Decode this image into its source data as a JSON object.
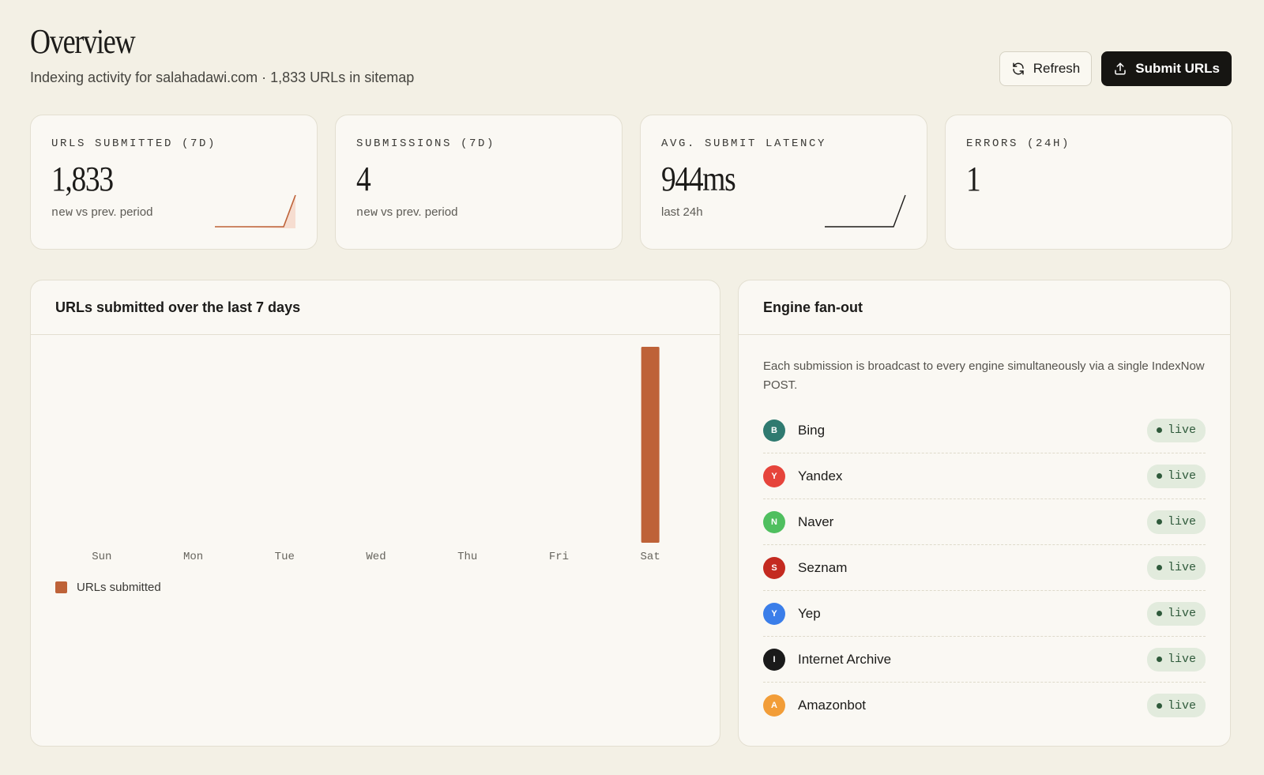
{
  "header": {
    "title": "Overview",
    "subtitle": "Indexing activity for salahadawi.com · 1,833 URLs in sitemap"
  },
  "actions": {
    "refresh_label": "Refresh",
    "submit_label": "Submit URLs"
  },
  "stats": [
    {
      "label": "URLS SUBMITTED (7D)",
      "value": "1,833",
      "note_mono": "new",
      "note_rest": " vs prev. period",
      "spark": "accent"
    },
    {
      "label": "SUBMISSIONS (7D)",
      "value": "4",
      "note_mono": "new",
      "note_rest": " vs prev. period",
      "spark": "none"
    },
    {
      "label": "AVG. SUBMIT LATENCY",
      "value": "944ms",
      "note_mono": "",
      "note_rest": "last 24h",
      "spark": "dark"
    },
    {
      "label": "ERRORS (24H)",
      "value": "1",
      "note_mono": "",
      "note_rest": "",
      "spark": "none"
    }
  ],
  "chart_panel": {
    "title": "URLs submitted over the last 7 days"
  },
  "chart_data": {
    "type": "bar",
    "categories": [
      "Sun",
      "Mon",
      "Tue",
      "Wed",
      "Thu",
      "Fri",
      "Sat"
    ],
    "series": [
      {
        "name": "URLs submitted",
        "values": [
          0,
          0,
          0,
          0,
          0,
          0,
          1833
        ]
      }
    ],
    "title": "URLs submitted over the last 7 days",
    "xlabel": "",
    "ylabel": "",
    "ylim": [
      0,
      1833
    ],
    "grid": false,
    "legend": "bottom-left",
    "color": "#be6238"
  },
  "engine_panel": {
    "title": "Engine fan-out",
    "description": "Each submission is broadcast to every engine simultaneously via a single IndexNow POST.",
    "engines": [
      {
        "initial": "B",
        "name": "Bing",
        "status": "live",
        "color": "#2f7a70"
      },
      {
        "initial": "Y",
        "name": "Yandex",
        "status": "live",
        "color": "#e6443b"
      },
      {
        "initial": "N",
        "name": "Naver",
        "status": "live",
        "color": "#4fbf5f"
      },
      {
        "initial": "S",
        "name": "Seznam",
        "status": "live",
        "color": "#c42a20"
      },
      {
        "initial": "Y",
        "name": "Yep",
        "status": "live",
        "color": "#3b7ee9"
      },
      {
        "initial": "I",
        "name": "Internet Archive",
        "status": "live",
        "color": "#1a1a1a"
      },
      {
        "initial": "A",
        "name": "Amazonbot",
        "status": "live",
        "color": "#f29d38"
      }
    ]
  },
  "colors": {
    "accent": "#be6238",
    "background": "#f3f0e5",
    "card": "#faf8f3",
    "live_bg": "#e2ebdd",
    "live_fg": "#2f5a3b"
  }
}
